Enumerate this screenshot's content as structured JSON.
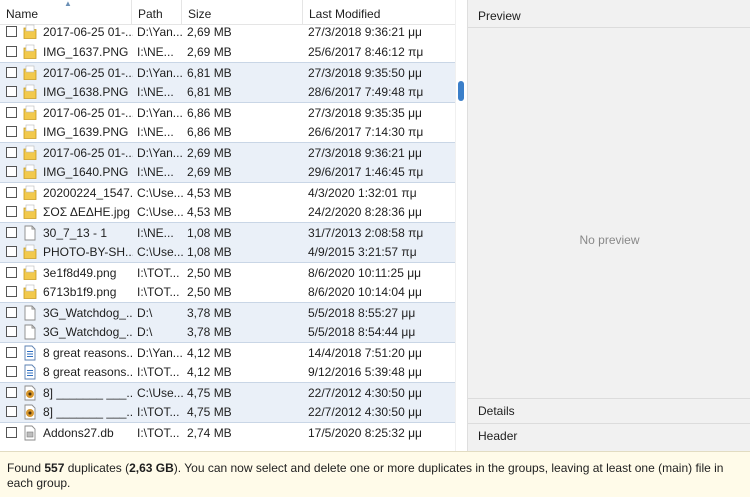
{
  "columns": {
    "name": "Name",
    "path": "Path",
    "size": "Size",
    "modified": "Last Modified"
  },
  "rows": [
    {
      "name": "2017-06-25 01-...",
      "path": "D:\\Yan...",
      "size": "2,69 MB",
      "modified": "27/3/2018 9:36:21 μμ",
      "icon": "folder-file-icon",
      "shaded": false,
      "groupStart": false
    },
    {
      "name": "IMG_1637.PNG",
      "path": "I:\\NE...",
      "size": "2,69 MB",
      "modified": "25/6/2017 8:46:12 πμ",
      "icon": "folder-file-icon",
      "shaded": false,
      "groupStart": false
    },
    {
      "name": "2017-06-25 01-...",
      "path": "D:\\Yan...",
      "size": "6,81 MB",
      "modified": "27/3/2018 9:35:50 μμ",
      "icon": "folder-file-icon",
      "shaded": true,
      "groupStart": true
    },
    {
      "name": "IMG_1638.PNG",
      "path": "I:\\NE...",
      "size": "6,81 MB",
      "modified": "28/6/2017 7:49:48 πμ",
      "icon": "folder-file-icon",
      "shaded": true,
      "groupStart": false
    },
    {
      "name": "2017-06-25 01-...",
      "path": "D:\\Yan...",
      "size": "6,86 MB",
      "modified": "27/3/2018 9:35:35 μμ",
      "icon": "folder-file-icon",
      "shaded": false,
      "groupStart": true
    },
    {
      "name": "IMG_1639.PNG",
      "path": "I:\\NE...",
      "size": "6,86 MB",
      "modified": "26/6/2017 7:14:30 πμ",
      "icon": "folder-file-icon",
      "shaded": false,
      "groupStart": false
    },
    {
      "name": "2017-06-25 01-...",
      "path": "D:\\Yan...",
      "size": "2,69 MB",
      "modified": "27/3/2018 9:36:21 μμ",
      "icon": "folder-file-icon",
      "shaded": true,
      "groupStart": true
    },
    {
      "name": "IMG_1640.PNG",
      "path": "I:\\NE...",
      "size": "2,69 MB",
      "modified": "29/6/2017 1:46:45 πμ",
      "icon": "folder-file-icon",
      "shaded": true,
      "groupStart": false
    },
    {
      "name": "20200224_1547...",
      "path": "C:\\Use...",
      "size": "4,53 MB",
      "modified": "4/3/2020 1:32:01 πμ",
      "icon": "folder-file-icon",
      "shaded": false,
      "groupStart": true
    },
    {
      "name": "ΣΟΣ ΔΕΔΗΕ.jpg",
      "path": "C:\\Use...",
      "size": "4,53 MB",
      "modified": "24/2/2020 8:28:36 μμ",
      "icon": "folder-file-icon",
      "shaded": false,
      "groupStart": false
    },
    {
      "name": "30_7_13 - 1",
      "path": "I:\\NE...",
      "size": "1,08 MB",
      "modified": "31/7/2013 2:08:58 πμ",
      "icon": "blank-file-icon",
      "shaded": true,
      "groupStart": true
    },
    {
      "name": "PHOTO-BY-SH...",
      "path": "C:\\Use...",
      "size": "1,08 MB",
      "modified": "4/9/2015 3:21:57 πμ",
      "icon": "folder-file-icon",
      "shaded": true,
      "groupStart": false
    },
    {
      "name": "3e1f8d49.png",
      "path": "I:\\TOT...",
      "size": "2,50 MB",
      "modified": "8/6/2020 10:11:25 μμ",
      "icon": "folder-file-icon",
      "shaded": false,
      "groupStart": true
    },
    {
      "name": "6713b1f9.png",
      "path": "I:\\TOT...",
      "size": "2,50 MB",
      "modified": "8/6/2020 10:14:04 μμ",
      "icon": "folder-file-icon",
      "shaded": false,
      "groupStart": false
    },
    {
      "name": "3G_Watchdog_...",
      "path": "D:\\",
      "size": "3,78 MB",
      "modified": "5/5/2018 8:55:27 μμ",
      "icon": "blank-file-icon",
      "shaded": true,
      "groupStart": true
    },
    {
      "name": "3G_Watchdog_...",
      "path": "D:\\",
      "size": "3,78 MB",
      "modified": "5/5/2018 8:54:44 μμ",
      "icon": "blank-file-icon",
      "shaded": true,
      "groupStart": false
    },
    {
      "name": "8 great reasons...",
      "path": "D:\\Yan...",
      "size": "4,12 MB",
      "modified": "14/4/2018 7:51:20 μμ",
      "icon": "document-file-icon",
      "shaded": false,
      "groupStart": true
    },
    {
      "name": "8 great reasons...",
      "path": "I:\\TOT...",
      "size": "4,12 MB",
      "modified": "9/12/2016 5:39:48 μμ",
      "icon": "document-file-icon",
      "shaded": false,
      "groupStart": false
    },
    {
      "name": "8] _______ ___...",
      "path": "C:\\Use...",
      "size": "4,75 MB",
      "modified": "22/7/2012 4:30:50 μμ",
      "icon": "media-file-icon",
      "shaded": true,
      "groupStart": true
    },
    {
      "name": "8] _______ ___...",
      "path": "I:\\TOT...",
      "size": "4,75 MB",
      "modified": "22/7/2012 4:30:50 μμ",
      "icon": "media-file-icon",
      "shaded": true,
      "groupStart": false
    },
    {
      "name": "Addons27.db",
      "path": "I:\\TOT...",
      "size": "2,74 MB",
      "modified": "17/5/2020 8:25:32 μμ",
      "icon": "database-file-icon",
      "shaded": false,
      "groupStart": true
    }
  ],
  "preview": {
    "title": "Preview",
    "empty_text": "No preview",
    "details_title": "Details",
    "header_title": "Header"
  },
  "status": {
    "prefix": "Found ",
    "count": "557",
    "mid": " duplicates (",
    "size": "2,63 GB",
    "suffix": "). You can now select and delete one or more duplicates in the groups, leaving at least one (main) file in each group."
  },
  "colors": {
    "group_shade": "#eaf0f8",
    "folder_yellow": "#f2c94c",
    "scroll_thumb": "#3b7fc9",
    "status_bg": "#fffbe9"
  }
}
